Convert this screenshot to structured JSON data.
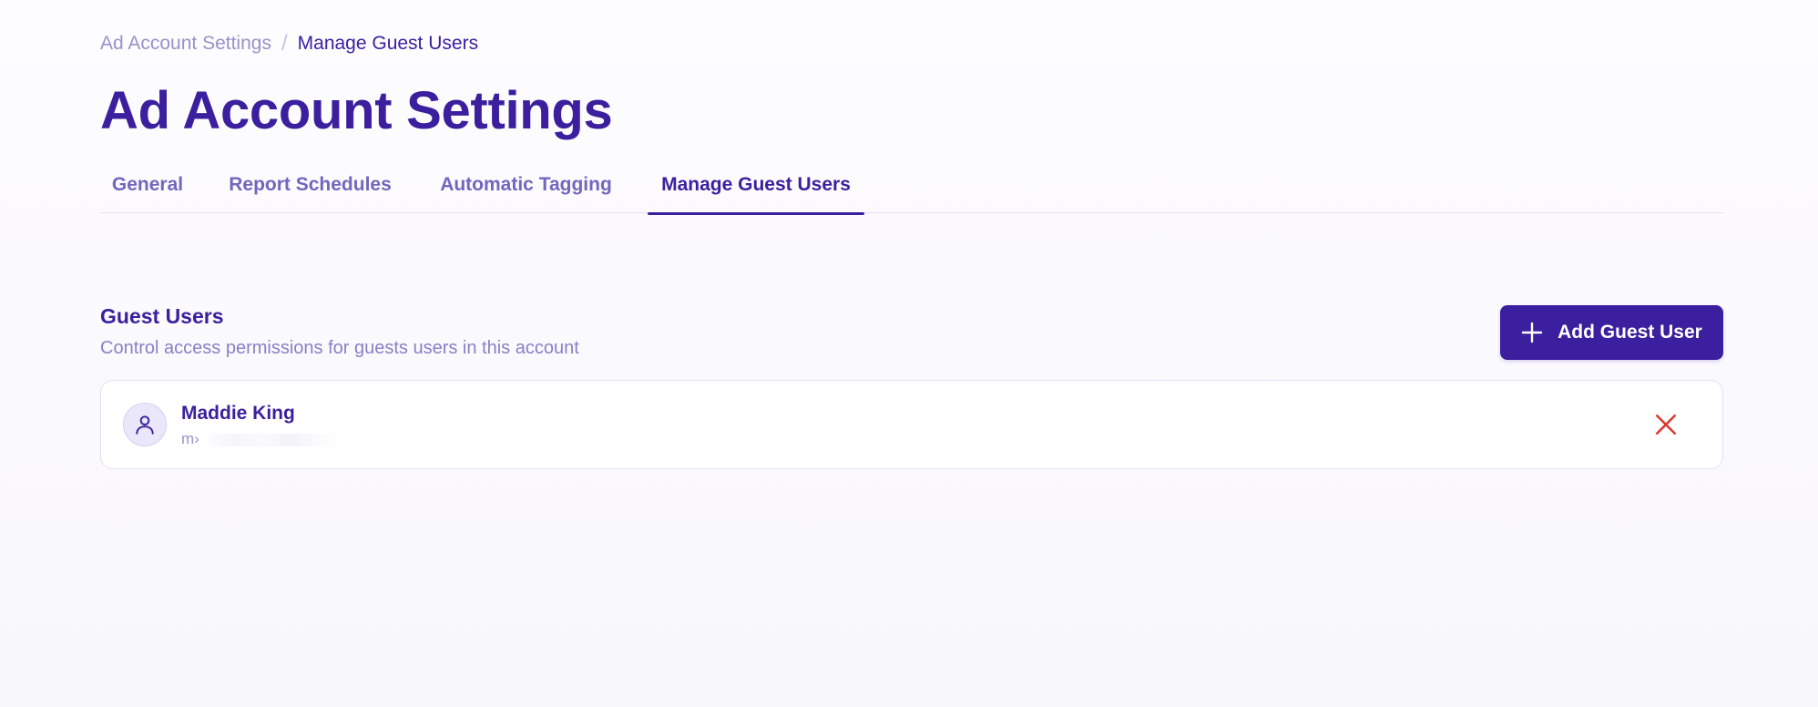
{
  "breadcrumb": {
    "parent": "Ad Account Settings",
    "separator": "/",
    "current": "Manage Guest Users"
  },
  "page_title": "Ad Account Settings",
  "tabs": [
    {
      "label": "General",
      "active": false
    },
    {
      "label": "Report Schedules",
      "active": false
    },
    {
      "label": "Automatic Tagging",
      "active": false
    },
    {
      "label": "Manage Guest Users",
      "active": true
    }
  ],
  "guest_section": {
    "title": "Guest Users",
    "subtitle": "Control access permissions for guests users in this account",
    "add_button_label": "Add Guest User",
    "add_icon": "plus-icon"
  },
  "guest_users": [
    {
      "name": "Maddie King",
      "email_visible": "m›",
      "avatar_icon": "user-icon",
      "remove_icon": "close-icon"
    }
  ],
  "colors": {
    "brand": "#3b1f9e",
    "tab_inactive": "#7266bd",
    "muted": "#9a91c9",
    "danger": "#d93a2e"
  }
}
